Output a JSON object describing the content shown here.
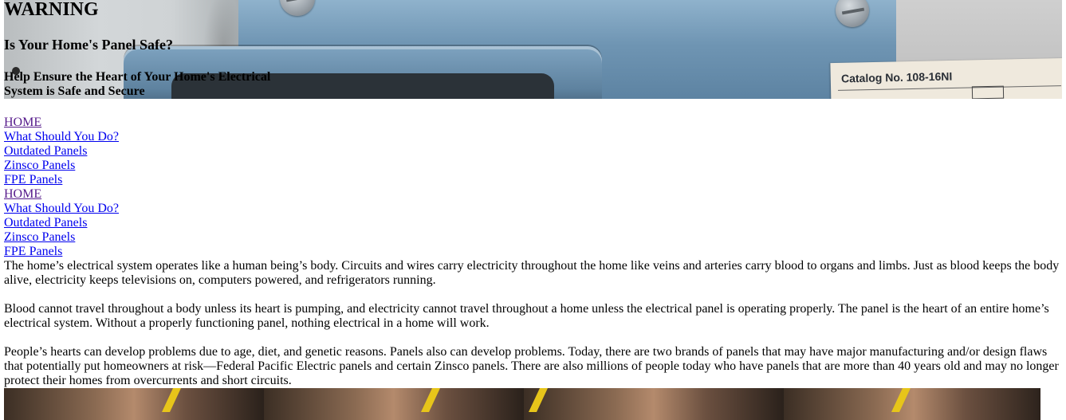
{
  "header": {
    "title": "WARNING",
    "subtitle": "Is Your Home's Panel Safe?",
    "tagline": "Help Ensure the Heart of Your Home's Electrical System is Safe and Secure",
    "image_label": "Catalog No. 108-16NI"
  },
  "nav": {
    "primary": [
      {
        "label": "HOME",
        "visited": true
      },
      {
        "label": "What Should You Do?",
        "visited": false
      },
      {
        "label": "Outdated Panels",
        "visited": false
      },
      {
        "label": "Zinsco Panels",
        "visited": false
      },
      {
        "label": "FPE Panels",
        "visited": false
      }
    ],
    "secondary": [
      {
        "label": "HOME",
        "visited": true
      },
      {
        "label": "What Should You Do?",
        "visited": false
      },
      {
        "label": "Outdated Panels",
        "visited": false
      },
      {
        "label": "Zinsco Panels",
        "visited": false
      },
      {
        "label": "FPE Panels",
        "visited": false
      }
    ]
  },
  "content": {
    "paragraphs": [
      "The home’s electrical system operates like a human being’s body. Circuits and wires carry electricity throughout the home like veins and arteries carry blood to organs and limbs. Just as blood keeps the body alive, electricity keeps televisions on, computers powered, and refrigerators running.",
      "Blood cannot travel throughout a body unless its heart is pumping, and electricity cannot travel throughout a home unless the electrical panel is operating properly. The panel is the heart of an entire home’s electrical system. Without a properly functioning panel, nothing electrical in a home will work.",
      "People’s hearts can develop problems due to age, diet, and genetic reasons. Panels also can develop problems. Today, there are two brands of panels that may have major manufacturing and/or design flaws that potentially put homeowners at risk—Federal Pacific Electric panels and certain Zinsco panels. There are also millions of people today who have panels that are more than 40 years old and may no longer protect their homes from overcurrents and short circuits."
    ]
  },
  "colors": {
    "link": "#0000ee",
    "link_visited": "#551a8b",
    "text": "#000000",
    "background": "#ffffff"
  }
}
